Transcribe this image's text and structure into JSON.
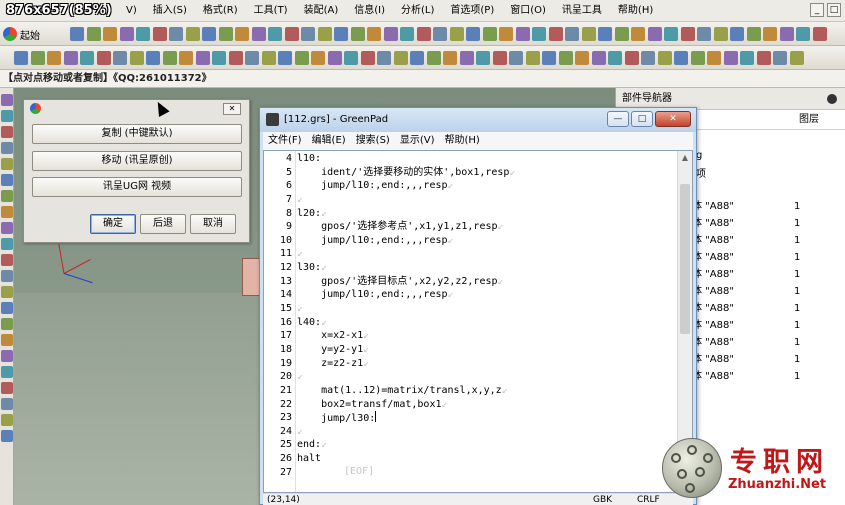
{
  "screen_badge": "876x657(85%)",
  "menubar": {
    "items": [
      "插入(S)",
      "格式(R)",
      "工具(T)",
      "装配(A)",
      "信息(I)",
      "分析(L)",
      "首选项(P)",
      "窗口(O)",
      "讯呈工具",
      "帮助(H)"
    ],
    "partial_first": "V)",
    "controls": [
      "_",
      "□"
    ]
  },
  "toolbar": {
    "start_label": "起始"
  },
  "status_line": "【点对点移动或者复制】《QQ:261011372》",
  "part_navigator": {
    "title": "部件导航器",
    "layer_header": "图层",
    "partial_text_1": "g",
    "partial_text_2": "项",
    "rows": [
      {
        "name": "体 \"A88\"",
        "layer": "1"
      },
      {
        "name": "体 \"A88\"",
        "layer": "1"
      },
      {
        "name": "体 \"A88\"",
        "layer": "1"
      },
      {
        "name": "体 \"A88\"",
        "layer": "1"
      },
      {
        "name": "体 \"A88\"",
        "layer": "1"
      },
      {
        "name": "体 \"A88\"",
        "layer": "1"
      },
      {
        "name": "体 \"A88\"",
        "layer": "1"
      },
      {
        "name": "体 \"A88\"",
        "layer": "1"
      },
      {
        "name": "体 \"A88\"",
        "layer": "1"
      },
      {
        "name": "体 \"A88\"",
        "layer": "1"
      },
      {
        "name": "体 \"A88\"",
        "layer": "1"
      }
    ]
  },
  "menu_dialog": {
    "close_glyph": "✕",
    "buttons": [
      "复制 (中键默认)",
      "移动 (讯呈原创)",
      "讯呈UG网 视频"
    ],
    "ok": "确定",
    "back": "后退",
    "cancel": "取消"
  },
  "greenpad": {
    "title": "[112.grs] - GreenPad",
    "controls": [
      "—",
      "□",
      "✕"
    ],
    "menus": [
      "文件(F)",
      "编辑(E)",
      "搜索(S)",
      "显示(V)",
      "帮助(H)"
    ],
    "lines": [
      {
        "n": "4",
        "text": "l10:"
      },
      {
        "n": "5",
        "text": "    ident/'选择要移动的实体',box1,resp"
      },
      {
        "n": "6",
        "text": "    jump/l10:,end:,,,resp"
      },
      {
        "n": "7",
        "text": ""
      },
      {
        "n": "8",
        "text": "l20:"
      },
      {
        "n": "9",
        "text": "    gpos/'选择参考点',x1,y1,z1,resp"
      },
      {
        "n": "10",
        "text": "    jump/l10:,end:,,,resp"
      },
      {
        "n": "11",
        "text": ""
      },
      {
        "n": "12",
        "text": "l30:"
      },
      {
        "n": "13",
        "text": "    gpos/'选择目标点',x2,y2,z2,resp"
      },
      {
        "n": "14",
        "text": "    jump/l10:,end:,,,resp"
      },
      {
        "n": "15",
        "text": ""
      },
      {
        "n": "16",
        "text": "l40:"
      },
      {
        "n": "17",
        "text": "    x=x2-x1"
      },
      {
        "n": "18",
        "text": "    y=y2-y1"
      },
      {
        "n": "19",
        "text": "    z=z2-z1"
      },
      {
        "n": "20",
        "text": ""
      },
      {
        "n": "21",
        "text": "    mat(1..12)=matrix/transl,x,y,z"
      },
      {
        "n": "22",
        "text": "    box2=transf/mat,box1"
      },
      {
        "n": "23",
        "text": "    jump/l30:"
      },
      {
        "n": "24",
        "text": ""
      },
      {
        "n": "25",
        "text": "end:"
      },
      {
        "n": "26",
        "text": "halt"
      },
      {
        "n": "27",
        "text": ""
      }
    ],
    "eol_mark": "↙",
    "eof": "[EOF]",
    "status": {
      "position": "(23,14)",
      "encoding": "GBK",
      "line_ending": "CRLF"
    }
  },
  "watermark": {
    "cn": "专职网",
    "url": "Zhuanzhi.Net"
  }
}
